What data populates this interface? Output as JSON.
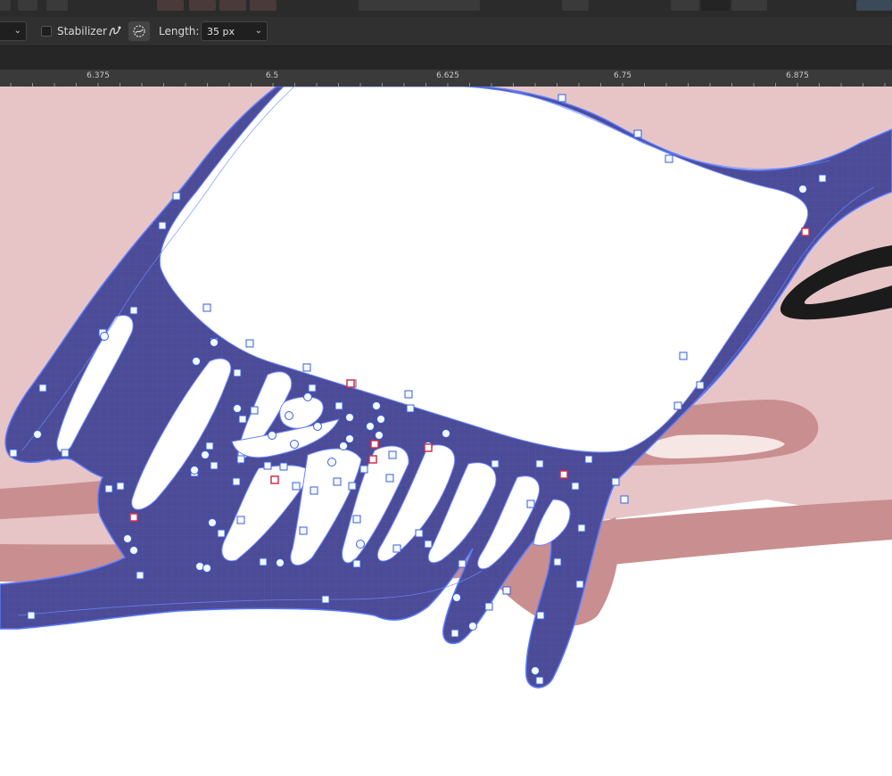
{
  "context_toolbar": {
    "stabilizer_label": "Stabilizer",
    "length_label": "Length:",
    "length_value": "35 px"
  },
  "ruler": {
    "ticks": [
      "6.375",
      "6.5",
      "6.625",
      "6.75",
      "6.875"
    ]
  },
  "colors": {
    "shape_fill": "#4b4b98",
    "shape_stroke": "#5a7cff",
    "background_pink": "#e8c6c8",
    "stripe_rose": "#c98e8f",
    "handle": "#2b2b2b",
    "ui_dark": "#303030",
    "ui_darker": "#2b2b2b"
  },
  "icons": [
    "rope-stabilizer-icon",
    "window-stabilizer-icon",
    "chevron-down-icon"
  ]
}
